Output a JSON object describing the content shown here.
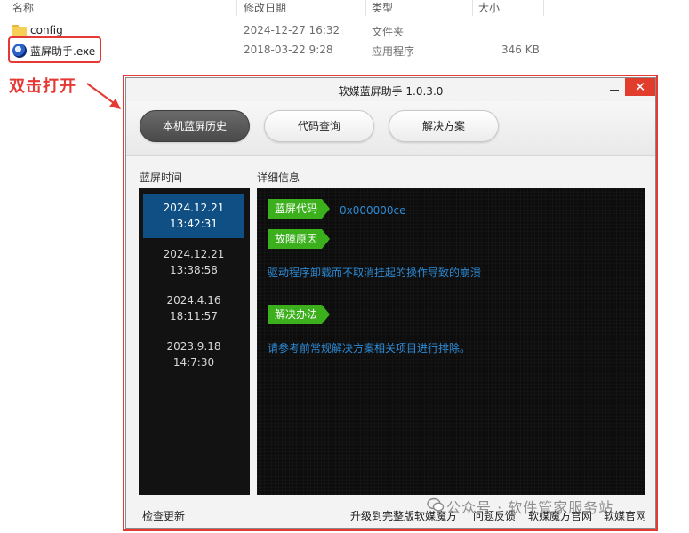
{
  "explorer": {
    "columns": {
      "name": "名称",
      "modified": "修改日期",
      "type": "类型",
      "size": "大小"
    },
    "files": [
      {
        "name": "config",
        "modified": "2024-12-27 16:32",
        "type": "文件夹",
        "size": "",
        "icon": "folder-icon"
      },
      {
        "name": "蓝屏助手.exe",
        "modified": "2018-03-22 9:28",
        "type": "应用程序",
        "size": "346 KB",
        "icon": "app-icon"
      }
    ]
  },
  "annotation": {
    "text": "双击打开",
    "color": "#e53935"
  },
  "app": {
    "title": "软媒蓝屏助手 1.0.3.0",
    "close_glyph": "✕",
    "tabs": [
      {
        "label": "本机蓝屏历史",
        "active": true
      },
      {
        "label": "代码查询",
        "active": false
      },
      {
        "label": "解决方案",
        "active": false
      }
    ],
    "history_label": "蓝屏时间",
    "detail_label": "详细信息",
    "history": [
      {
        "date": "2024.12.21",
        "time": "13:42:31",
        "selected": true
      },
      {
        "date": "2024.12.21",
        "time": "13:38:58",
        "selected": false
      },
      {
        "date": "2024.4.16",
        "time": "18:11:57",
        "selected": false
      },
      {
        "date": "2023.9.18",
        "time": "14:7:30",
        "selected": false
      }
    ],
    "detail": {
      "code_tag": "蓝屏代码",
      "code_value": "0x000000ce",
      "cause_tag": "故障原因",
      "cause_text": "驱动程序卸载而不取消挂起的操作导致的崩溃",
      "solution_tag": "解决办法",
      "solution_text": "请参考前常规解决方案相关项目进行排除。"
    },
    "footer": {
      "check_update": "检查更新",
      "upgrade": "升级到完整版软媒魔方",
      "feedback": "问题反馈",
      "mofang_site": "软媒魔方官网",
      "ruanmei_site": "软媒官网"
    },
    "colors": {
      "accent_tag": "#3bb01c",
      "selected_row": "#0f4f84",
      "detail_text": "#2d8bd6",
      "close_button": "#e23c2c"
    }
  },
  "watermark": "公众号 · 软件管家服务站"
}
